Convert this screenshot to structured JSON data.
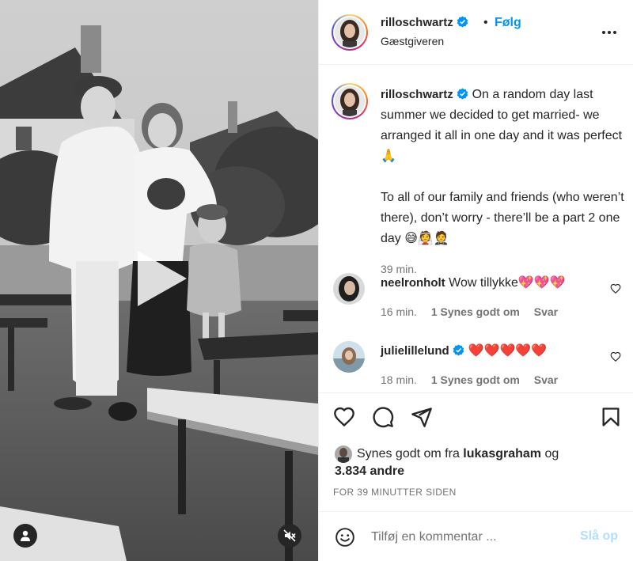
{
  "post": {
    "author": "rilloschwartz",
    "subtitle": "Gæstgiveren",
    "follow_label": "Følg",
    "more_icon": "more-horizontal-icon",
    "verified_color": "#0095f6"
  },
  "caption": {
    "username": "rilloschwartz",
    "line1": "On a random day last summer we decided to get married- we arranged it all in one day and it was perfect 🙏",
    "line2": "To all of our family and friends (who weren’t there), don’t worry - there’ll be a part 2 one day 😅👰🤵",
    "time": "39 min."
  },
  "comments": [
    {
      "username": "neelronholt",
      "text": "Wow tillykke💖💖💖",
      "time": "16 min.",
      "likes": "1 Synes godt om",
      "reply": "Svar",
      "verified": false
    },
    {
      "username": "julielillelund",
      "text": "❤️❤️❤️❤️❤️",
      "time": "18 min.",
      "likes": "1 Synes godt om",
      "reply": "Svar",
      "verified": true
    }
  ],
  "likes": {
    "prefix": "Synes godt om fra",
    "user": "lukasgraham",
    "connector": "og",
    "others": "3.834 andre"
  },
  "timestamp": "FOR 39 MINUTTER SIDEN",
  "add_comment": {
    "placeholder": "Tilføj en kommentar ...",
    "post_label": "Slå op",
    "emoji_icon": "emoji-icon"
  },
  "colors": {
    "accent": "#0095f6",
    "post_disabled": "#b2dffc",
    "muted_text": "#737373"
  }
}
